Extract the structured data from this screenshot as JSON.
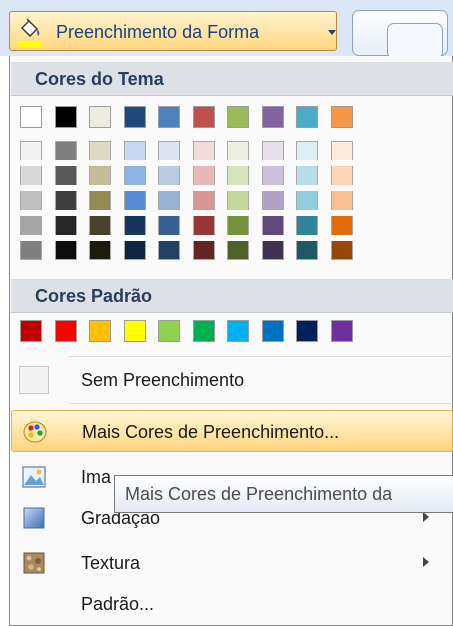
{
  "toolbar": {
    "fill_button_label": "Preenchimento da Forma",
    "fill_button_icon": "paint-bucket-icon",
    "fill_button_color": "#FFFF00"
  },
  "theme_colors": {
    "header": "Cores do Tema",
    "base": [
      "#FFFFFF",
      "#000000",
      "#EEECE1",
      "#1F497D",
      "#4F81BD",
      "#C0504D",
      "#9BBB59",
      "#8064A2",
      "#4BACC6",
      "#F79646"
    ],
    "shades": [
      [
        "#F2F2F2",
        "#D8D8D8",
        "#BFBFBF",
        "#A5A5A5",
        "#7F7F7F"
      ],
      [
        "#7F7F7F",
        "#595959",
        "#3F3F3F",
        "#262626",
        "#0C0C0C"
      ],
      [
        "#DDD9C3",
        "#C4BD97",
        "#938953",
        "#494429",
        "#1D1B10"
      ],
      [
        "#C6D9F0",
        "#8DB3E2",
        "#548DD4",
        "#17365D",
        "#0F243E"
      ],
      [
        "#DBE5F1",
        "#B8CCE4",
        "#95B3D7",
        "#366092",
        "#244061"
      ],
      [
        "#F2DCDB",
        "#E5B9B7",
        "#D99694",
        "#953734",
        "#632423"
      ],
      [
        "#EBF1DD",
        "#D7E3BC",
        "#C3D69B",
        "#76923C",
        "#4F6128"
      ],
      [
        "#E5E0EC",
        "#CCC1D9",
        "#B2A2C7",
        "#5F497A",
        "#3F3151"
      ],
      [
        "#DBEEF3",
        "#B7DDE8",
        "#92CDDC",
        "#31859B",
        "#205867"
      ],
      [
        "#FDEADA",
        "#FBD5B5",
        "#FAC08F",
        "#E36C09",
        "#974806"
      ]
    ]
  },
  "standard_colors": {
    "header": "Cores Padrão",
    "colors": [
      "#C00000",
      "#FF0000",
      "#FFC000",
      "#FFFF00",
      "#92D050",
      "#00B050",
      "#00B0F0",
      "#0070C0",
      "#002060",
      "#7030A0"
    ]
  },
  "menu": {
    "no_fill": "Sem Preenchimento",
    "more_colors": "Mais Cores de Preenchimento...",
    "image": "Ima",
    "gradient": "Gradação",
    "texture": "Textura",
    "pattern": "Padrão..."
  },
  "tooltip": "Mais Cores de Preenchimento da"
}
